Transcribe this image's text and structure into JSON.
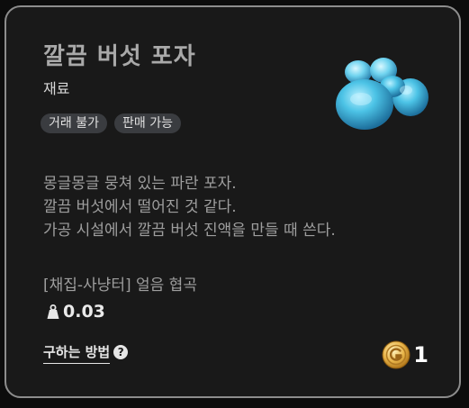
{
  "item": {
    "name": "깔끔 버섯 포자",
    "category": "재료",
    "image_icon": "mushroom-spore-icon",
    "tags": [
      "거래 불가",
      "판매 가능"
    ],
    "description": [
      "몽글몽글 뭉쳐 있는 파란 포자.",
      "깔끔 버섯에서 떨어진 것 같다.",
      "가공 시설에서 깔끔 버섯 진액을 만들 때 쓴다."
    ],
    "source": "[채집-사냥터] 얼음 협곡",
    "weight": "0.03",
    "weight_icon": "weight-icon"
  },
  "how_to_obtain": {
    "label": "구하는 방법",
    "icon": "help-icon",
    "icon_glyph": "?"
  },
  "price": {
    "value": "1",
    "icon": "gold-coin-icon"
  },
  "colors": {
    "background": "#191919",
    "border": "#8d8d8d",
    "badge": "#3a3c40",
    "spore": "#3fb6dd",
    "coin": "#e0a83a"
  }
}
